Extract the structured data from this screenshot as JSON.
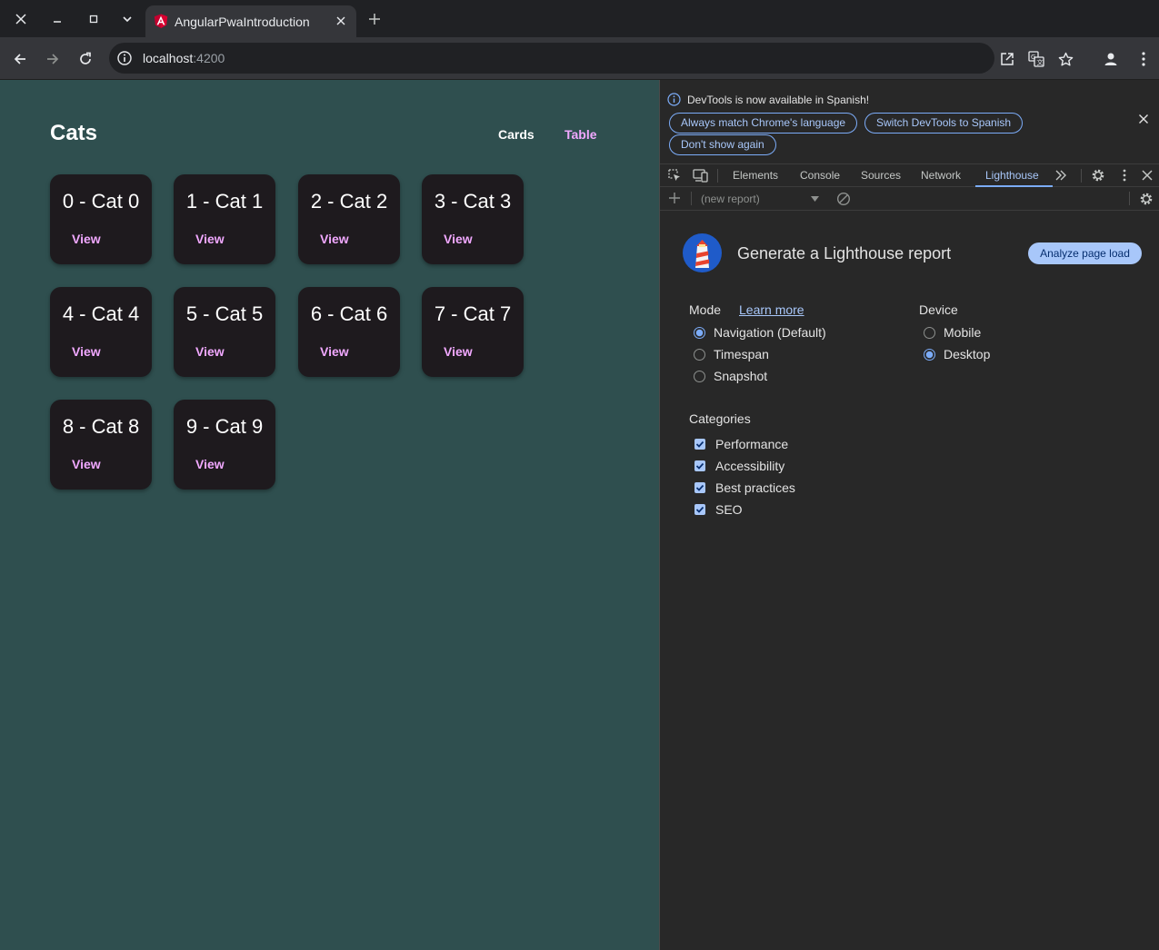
{
  "browser": {
    "tab_title": "AngularPwaIntroduction",
    "url_host": "localhost",
    "url_port": ":4200"
  },
  "app": {
    "title": "Cats",
    "nav_cards": "Cards",
    "nav_table": "Table",
    "accent_color": "#f1a8ff",
    "background_color": "#2f4f4f",
    "cards": [
      {
        "title": "0 - Cat 0",
        "action": "View"
      },
      {
        "title": "1 - Cat 1",
        "action": "View"
      },
      {
        "title": "2 - Cat 2",
        "action": "View"
      },
      {
        "title": "3 - Cat 3",
        "action": "View"
      },
      {
        "title": "4 - Cat 4",
        "action": "View"
      },
      {
        "title": "5 - Cat 5",
        "action": "View"
      },
      {
        "title": "6 - Cat 6",
        "action": "View"
      },
      {
        "title": "7 - Cat 7",
        "action": "View"
      },
      {
        "title": "8 - Cat 8",
        "action": "View"
      },
      {
        "title": "9 - Cat 9",
        "action": "View"
      }
    ]
  },
  "devtools": {
    "info_text": "DevTools is now available in Spanish!",
    "btn_match": "Always match Chrome's language",
    "btn_switch": "Switch DevTools to Spanish",
    "btn_dont_show": "Don't show again",
    "tabs": [
      "Elements",
      "Console",
      "Sources",
      "Network",
      "Lighthouse"
    ],
    "active_tab": "Lighthouse",
    "report_select": "(new report)",
    "lighthouse": {
      "title": "Generate a Lighthouse report",
      "analyze_button": "Analyze page load",
      "mode_label": "Mode",
      "learn_more": "Learn more",
      "mode_options": [
        "Navigation (Default)",
        "Timespan",
        "Snapshot"
      ],
      "mode_selected": "Navigation (Default)",
      "device_label": "Device",
      "device_options": [
        "Mobile",
        "Desktop"
      ],
      "device_selected": "Desktop",
      "categories_label": "Categories",
      "categories": [
        "Performance",
        "Accessibility",
        "Best practices",
        "SEO"
      ]
    }
  }
}
